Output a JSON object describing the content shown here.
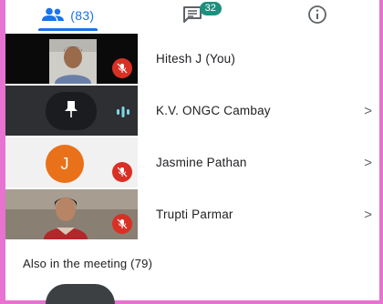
{
  "tabs": {
    "people_count": "(83)",
    "chat_badge": "32"
  },
  "participants": [
    {
      "name": "Hitesh J (You)",
      "muted": true
    },
    {
      "name": "K.V. ONGC Cambay",
      "muted": false
    },
    {
      "name": "Jasmine Pathan",
      "initial": "J",
      "muted": true
    },
    {
      "name": "Trupti Parmar",
      "muted": true
    }
  ],
  "also_in_meeting": "Also in the meeting (79)",
  "chevron": ">",
  "colors": {
    "accent": "#1a73e8",
    "badge": "#1e8e7e",
    "mute": "#d93025",
    "avatar_orange": "#e8711a",
    "frame": "#e872d0"
  }
}
